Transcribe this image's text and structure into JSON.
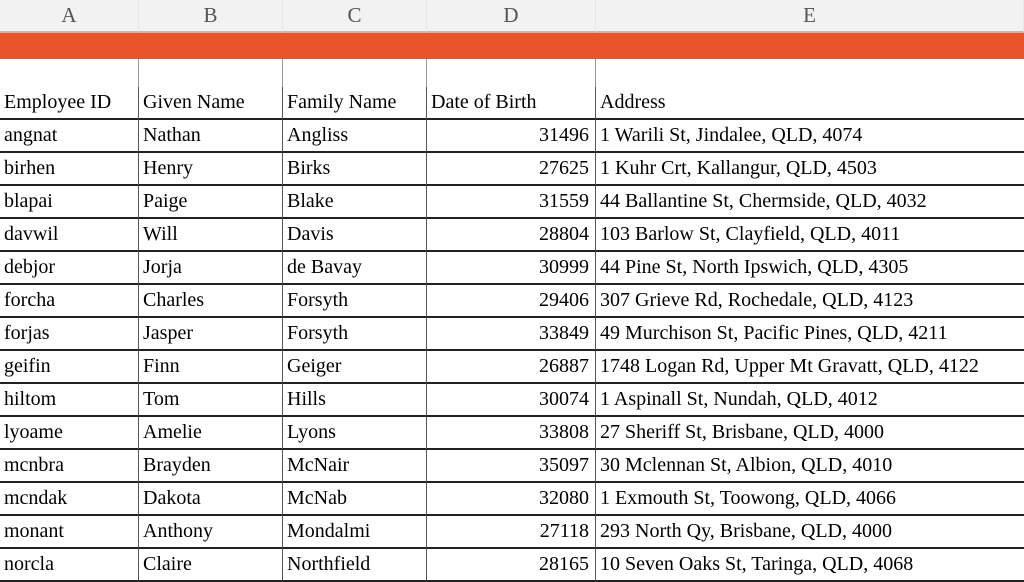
{
  "columns": [
    "A",
    "B",
    "C",
    "D",
    "E"
  ],
  "orange_color": "#e9542b",
  "headers": {
    "employee_id": "Employee ID",
    "given_name": "Given Name",
    "family_name": "Family Name",
    "dob": "Date of Birth",
    "address": "Address"
  },
  "rows": [
    {
      "id": "angnat",
      "given": "Nathan",
      "family": "Angliss",
      "dob": 31496,
      "address": "1 Warili St, Jindalee, QLD, 4074"
    },
    {
      "id": "birhen",
      "given": "Henry",
      "family": "Birks",
      "dob": 27625,
      "address": "1 Kuhr Crt, Kallangur, QLD, 4503"
    },
    {
      "id": "blapai",
      "given": "Paige",
      "family": "Blake",
      "dob": 31559,
      "address": "44 Ballantine St, Chermside, QLD, 4032"
    },
    {
      "id": "davwil",
      "given": "Will",
      "family": "Davis",
      "dob": 28804,
      "address": "103 Barlow St, Clayfield, QLD, 4011"
    },
    {
      "id": "debjor",
      "given": "Jorja",
      "family": "de Bavay",
      "dob": 30999,
      "address": "44 Pine St, North Ipswich, QLD, 4305"
    },
    {
      "id": "forcha",
      "given": "Charles",
      "family": "Forsyth",
      "dob": 29406,
      "address": "307 Grieve Rd, Rochedale, QLD, 4123"
    },
    {
      "id": "forjas",
      "given": "Jasper",
      "family": "Forsyth",
      "dob": 33849,
      "address": "49 Murchison St, Pacific Pines, QLD, 4211"
    },
    {
      "id": "geifin",
      "given": "Finn",
      "family": "Geiger",
      "dob": 26887,
      "address": "1748 Logan Rd, Upper Mt Gravatt, QLD, 4122"
    },
    {
      "id": "hiltom",
      "given": "Tom",
      "family": "Hills",
      "dob": 30074,
      "address": "1 Aspinall St, Nundah, QLD, 4012"
    },
    {
      "id": "lyoame",
      "given": "Amelie",
      "family": "Lyons",
      "dob": 33808,
      "address": "27 Sheriff St, Brisbane, QLD, 4000"
    },
    {
      "id": "mcnbra",
      "given": "Brayden",
      "family": "McNair",
      "dob": 35097,
      "address": "30 Mclennan St, Albion, QLD, 4010"
    },
    {
      "id": "mcndak",
      "given": "Dakota",
      "family": "McNab",
      "dob": 32080,
      "address": "1 Exmouth St, Toowong, QLD, 4066"
    },
    {
      "id": "monant",
      "given": "Anthony",
      "family": "Mondalmi",
      "dob": 27118,
      "address": "293 North Qy, Brisbane, QLD, 4000"
    },
    {
      "id": "norcla",
      "given": "Claire",
      "family": "Northfield",
      "dob": 28165,
      "address": "10 Seven Oaks St, Taringa, QLD, 4068"
    }
  ]
}
